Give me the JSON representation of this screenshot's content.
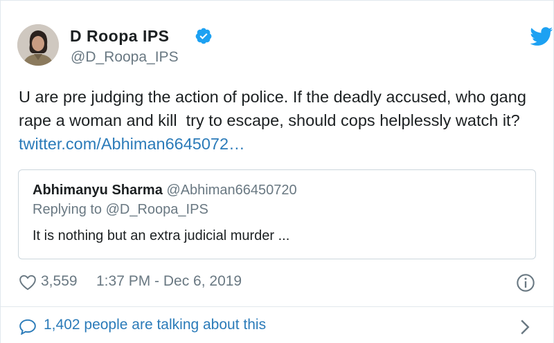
{
  "author": {
    "name": "D Roopa IPS",
    "handle": "@D_Roopa_IPS"
  },
  "tweet": {
    "text": "U are pre judging the action of police. If the deadly accused, who gang rape a woman and kill  try to escape, should cops helplessly watch it? ",
    "link": "twitter.com/Abhiman6645072…"
  },
  "quoted": {
    "name": "Abhimanyu Sharma",
    "handle": "@Abhiman66450720",
    "replying": "Replying to @D_Roopa_IPS",
    "text": "It is nothing but an extra judicial murder ..."
  },
  "meta": {
    "likes": "3,559",
    "timestamp": "1:37 PM - Dec 6, 2019"
  },
  "footer": {
    "talking": "1,402 people are talking about this"
  },
  "colors": {
    "link": "#2b7bb9",
    "verified": "#1da1f2",
    "secondary_text": "#697882"
  },
  "icons": [
    "verified-badge-icon",
    "twitter-bird-icon",
    "heart-icon",
    "info-icon",
    "speech-bubble-icon",
    "chevron-right-icon"
  ]
}
